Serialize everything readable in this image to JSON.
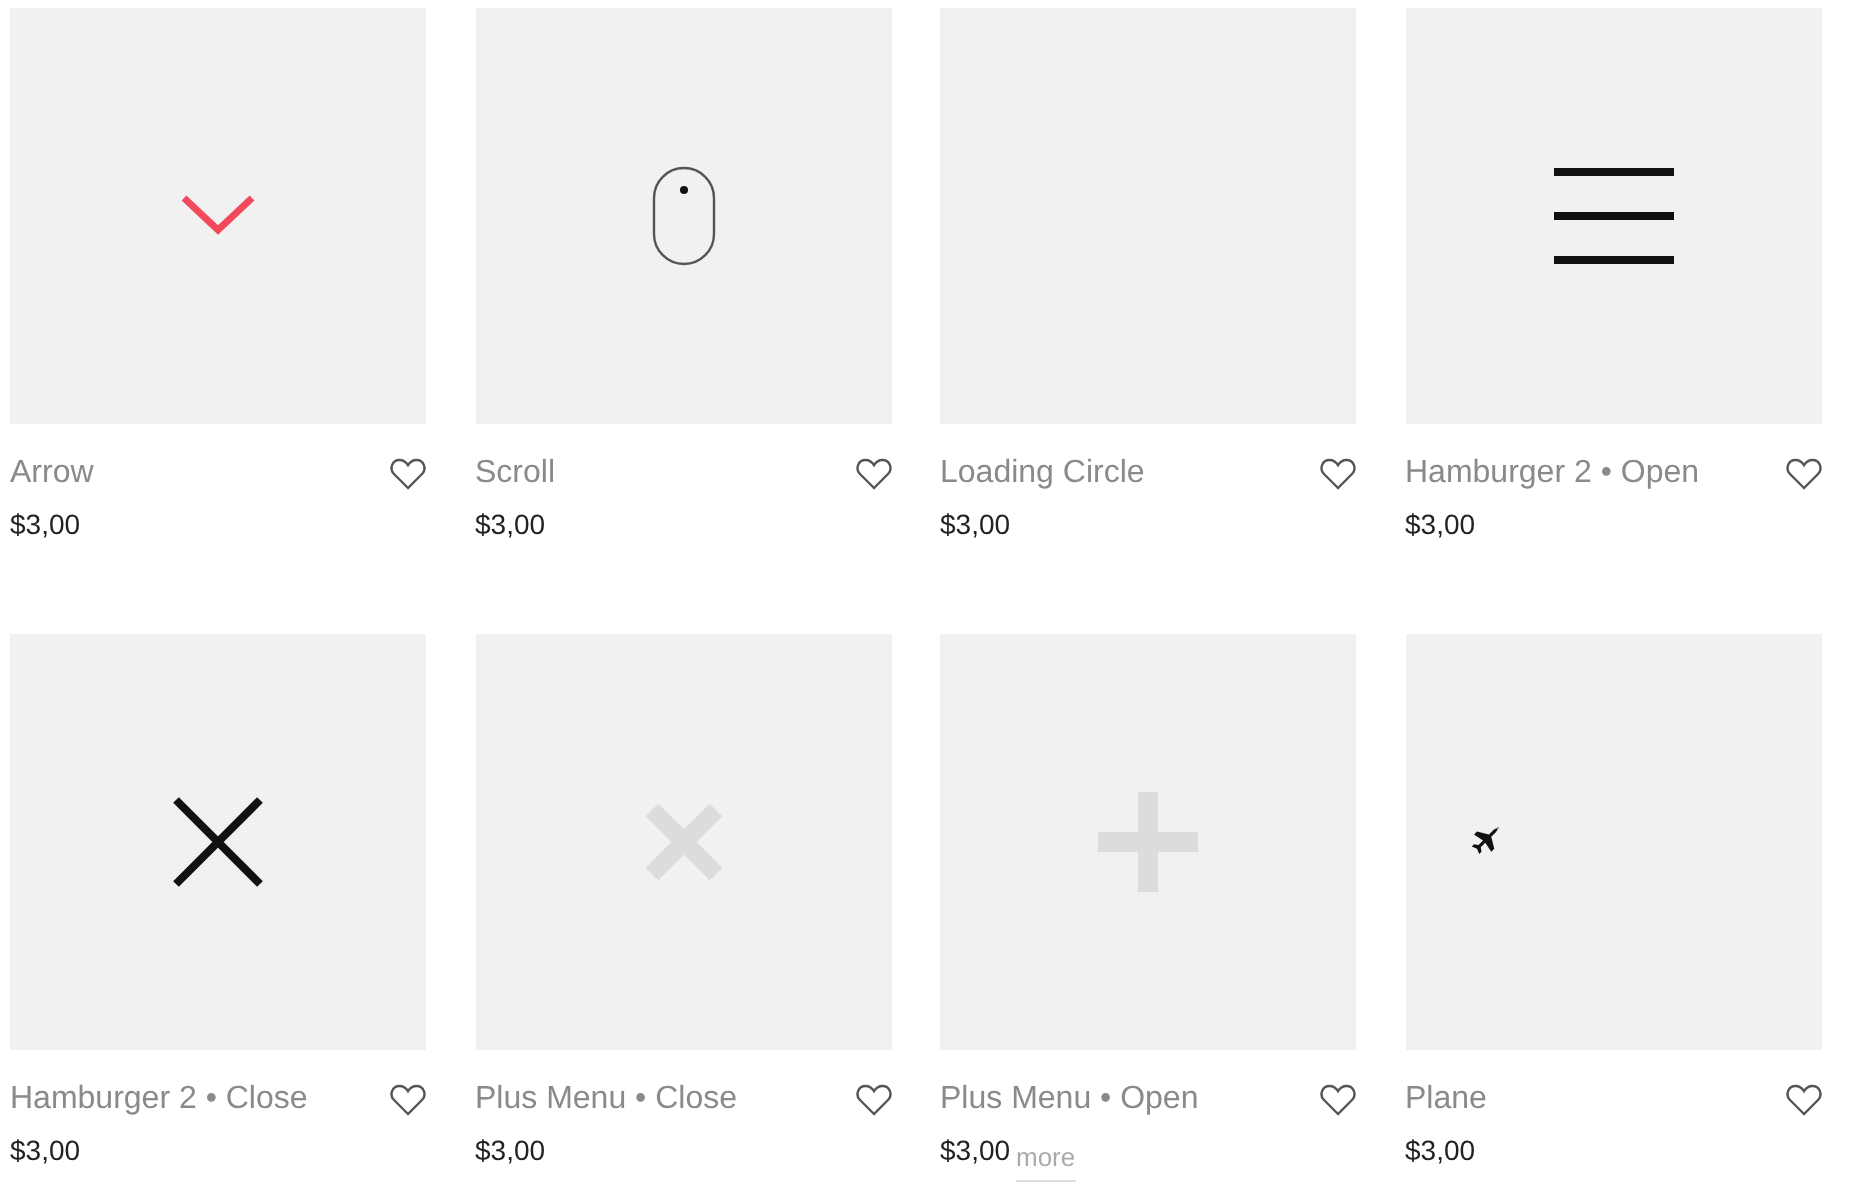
{
  "products": [
    {
      "title": "Arrow",
      "price": "$3,00",
      "kind": "chevron"
    },
    {
      "title": "Scroll",
      "price": "$3,00",
      "kind": "mouse"
    },
    {
      "title": "Loading Circle",
      "price": "$3,00",
      "kind": "blank"
    },
    {
      "title": "Hamburger 2 • Open",
      "price": "$3,00",
      "kind": "hamburger"
    },
    {
      "title": "Hamburger 2 • Close",
      "price": "$3,00",
      "kind": "cross"
    },
    {
      "title": "Plus Menu • Close",
      "price": "$3,00",
      "kind": "cross-light"
    },
    {
      "title": "Plus Menu • Open",
      "price": "$3,00",
      "kind": "plus"
    },
    {
      "title": "Plane",
      "price": "$3,00",
      "kind": "plane"
    }
  ],
  "load_more": {
    "label": "more"
  }
}
